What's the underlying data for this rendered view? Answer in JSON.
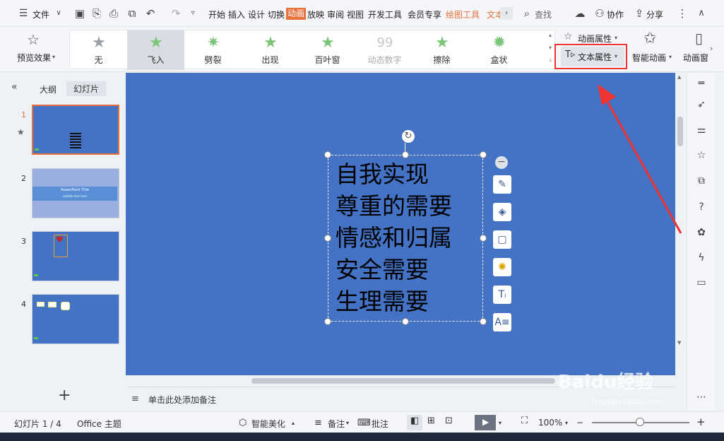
{
  "menubar": {
    "file": "文件",
    "tabs": [
      "开始",
      "插入",
      "设计",
      "切换",
      "动画",
      "放映",
      "审阅",
      "视图",
      "开发工具",
      "会员专享",
      "绘图工具",
      "文本"
    ],
    "active_tab": "动画",
    "search": "查找",
    "collab": "协作",
    "share": "分享"
  },
  "ribbon": {
    "preview": "预览效果",
    "gallery": [
      {
        "label": "无",
        "color": "#9aa0a6"
      },
      {
        "label": "飞入",
        "color": "#7cc47a"
      },
      {
        "label": "劈裂",
        "color": "#7cc47a"
      },
      {
        "label": "出现",
        "color": "#7cc47a"
      },
      {
        "label": "百叶窗",
        "color": "#7cc47a"
      },
      {
        "label": "动态数字",
        "color": "#c8c8c8"
      },
      {
        "label": "擦除",
        "color": "#7cc47a"
      },
      {
        "label": "盒状",
        "color": "#7cc47a"
      }
    ],
    "anim_props": "动画属性",
    "text_props": "文本属性",
    "smart_anim": "智能动画",
    "anim_panel": "动画窗"
  },
  "leftpanel": {
    "tab_outline": "大纲",
    "tab_slides": "幻灯片",
    "slides": [
      {
        "num": "1"
      },
      {
        "num": "2",
        "title": "PowerPoint Title",
        "subtitle": "subtitle text here"
      },
      {
        "num": "3"
      },
      {
        "num": "4"
      }
    ]
  },
  "slide": {
    "lines": [
      "自我实现",
      "尊重的需要",
      "情感和归属",
      "安全需要",
      "生理需要"
    ]
  },
  "notes": {
    "placeholder": "单击此处添加备注"
  },
  "status": {
    "slide_count": "幻灯片 1 / 4",
    "theme": "Office 主题",
    "beautify": "智能美化",
    "notes": "备注",
    "comment": "批注",
    "zoom": "100%"
  },
  "watermark": {
    "brand": "Baidu经验",
    "url": "jingyan.baidu.com"
  },
  "colors": {
    "accent": "#e8703a",
    "slide_bg": "#4472c4",
    "highlight": "#ee3333"
  }
}
